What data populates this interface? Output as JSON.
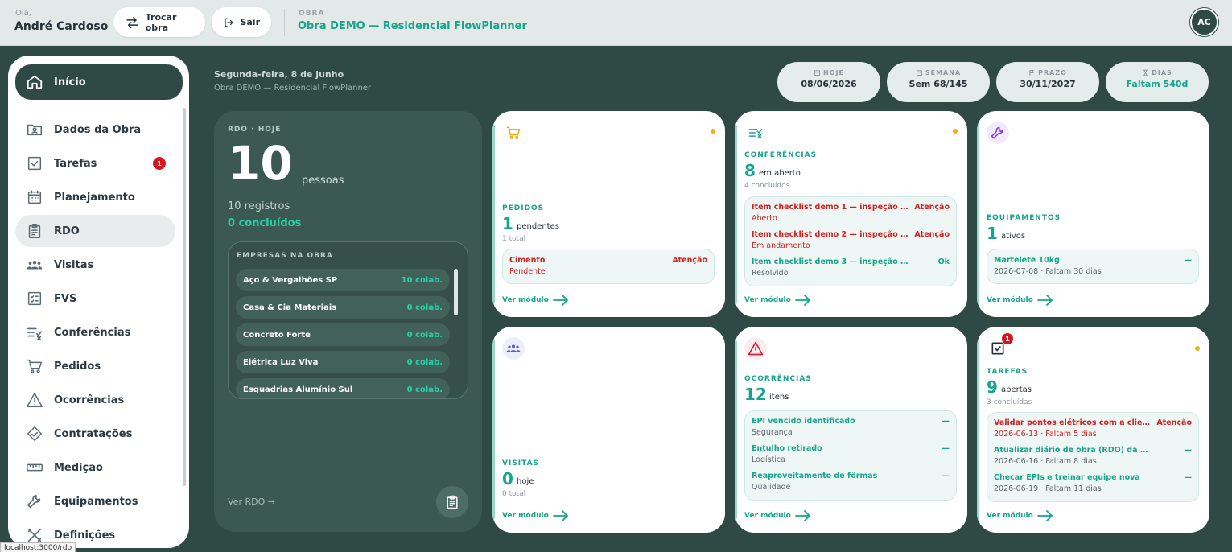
{
  "topbar": {
    "greeting": "Olá,",
    "user_name": "André Cardoso",
    "switch_label": "Trocar obra",
    "logout_label": "Sair",
    "obra_label": "OBRA",
    "obra_name": "Obra DEMO — Residencial FlowPlanner",
    "avatar_initials": "AC"
  },
  "sidebar": {
    "items": [
      {
        "label": "Início",
        "icon": "home-icon"
      },
      {
        "label": "Dados da Obra",
        "icon": "folder-user-icon"
      },
      {
        "label": "Tarefas",
        "icon": "checkbox-icon",
        "badge": "1"
      },
      {
        "label": "Planejamento",
        "icon": "calendar-icon"
      },
      {
        "label": "RDO",
        "icon": "clipboard-icon"
      },
      {
        "label": "Visitas",
        "icon": "people-icon"
      },
      {
        "label": "FVS",
        "icon": "checklist-icon"
      },
      {
        "label": "Conferências",
        "icon": "list-check-icon"
      },
      {
        "label": "Pedidos",
        "icon": "cart-icon"
      },
      {
        "label": "Ocorrências",
        "icon": "warning-icon"
      },
      {
        "label": "Contratações",
        "icon": "handshake-icon"
      },
      {
        "label": "Medição",
        "icon": "ruler-icon"
      },
      {
        "label": "Equipamentos",
        "icon": "wrench-icon"
      },
      {
        "label": "Definições",
        "icon": "tools-icon"
      }
    ],
    "url_tooltip": "localhost:3000/rdo"
  },
  "header": {
    "date": "Segunda-feira, 8 de junho",
    "obra_sub": "Obra DEMO — Residencial FlowPlanner",
    "stats": [
      {
        "label": "HOJE",
        "value": "08/06/2026",
        "icon": "calendar-icon"
      },
      {
        "label": "SEMANA",
        "value": "Sem 68/145",
        "icon": "calendar-icon"
      },
      {
        "label": "PRAZO",
        "value": "30/11/2027",
        "icon": "flag-icon"
      },
      {
        "label": "DIAS",
        "value": "Faltam 540d",
        "icon": "hourglass-icon"
      }
    ]
  },
  "rdo": {
    "label": "RDO · HOJE",
    "count": "10",
    "unit": "pessoas",
    "registros": "10 registros",
    "concluidos": "0 concluídos",
    "empresas_title": "EMPRESAS NA OBRA",
    "empresas": [
      {
        "name": "Aço & Vergalhões SP",
        "count": "10 colab."
      },
      {
        "name": "Casa & Cia Materiais",
        "count": "0 colab."
      },
      {
        "name": "Concreto Forte",
        "count": "0 colab."
      },
      {
        "name": "Elétrica Luz Viva",
        "count": "0 colab."
      },
      {
        "name": "Esquadrias Alumínio Sul",
        "count": "0 colab."
      }
    ],
    "ver_link": "Ver RDO →"
  },
  "cards": {
    "ver_modulo": "Ver módulo",
    "pedidos": {
      "label": "PEDIDOS",
      "count": "1",
      "unit": "pendentes",
      "sub": "1 total",
      "items": [
        {
          "title": "Cimento",
          "status": "Atenção",
          "sub": "Pendente"
        }
      ]
    },
    "conferencias": {
      "label": "CONFERÊNCIAS",
      "count": "8",
      "unit": "em aberto",
      "sub": "4 concluídos",
      "items": [
        {
          "title": "Item checklist demo 1 — inspeção de aca...",
          "status": "Atenção",
          "sub": "Aberto"
        },
        {
          "title": "Item checklist demo 2 — inspeção de ac...",
          "status": "Atenção",
          "sub": "Em andamento"
        },
        {
          "title": "Item checklist demo 3 — inspeção de acabam...",
          "status": "Ok",
          "sub": "Resolvido"
        }
      ]
    },
    "equipamentos": {
      "label": "EQUIPAMENTOS",
      "count": "1",
      "unit": "ativos",
      "items": [
        {
          "title": "Martelete 10kg",
          "status": "—",
          "sub": "2026-07-08 · Faltam 30 dias"
        }
      ]
    },
    "visitas": {
      "label": "VISITAS",
      "count": "0",
      "unit": "hoje",
      "sub": "0 total"
    },
    "ocorrencias": {
      "label": "OCORRÊNCIAS",
      "count": "12",
      "unit": "itens",
      "items": [
        {
          "title": "EPI vencido identificado",
          "status": "—",
          "sub": "Segurança"
        },
        {
          "title": "Entulho retirado",
          "status": "—",
          "sub": "Logística"
        },
        {
          "title": "Reaproveitamento de fôrmas",
          "status": "—",
          "sub": "Qualidade"
        }
      ]
    },
    "tarefas": {
      "label": "TAREFAS",
      "count": "9",
      "unit": "abertas",
      "sub": "3 concluídas",
      "badge": "1",
      "items": [
        {
          "title": "Validar pontos elétricos com a cliente",
          "status": "Atenção",
          "sub": "2026-06-13 · Faltam 5 dias"
        },
        {
          "title": "Atualizar diário de obra (RDO) da semana",
          "status": "—",
          "sub": "2026-06-16 · Faltam 8 dias"
        },
        {
          "title": "Checar EPIs e treinar equipe nova",
          "status": "—",
          "sub": "2026-06-19 · Faltam 11 dias"
        }
      ]
    }
  },
  "colors": {
    "brand_dark": "#2f4a44",
    "accent": "#15a58a",
    "alert": "#d21f1f",
    "warning_dot": "#f2b008"
  }
}
